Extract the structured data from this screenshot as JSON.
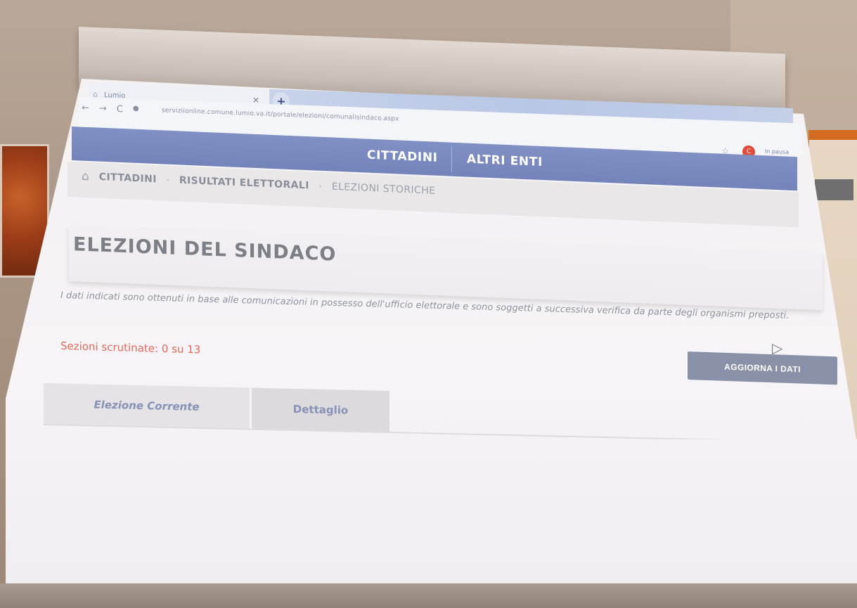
{
  "browser": {
    "tab_title": "Lumio",
    "tab_close": "×",
    "new_tab": "+",
    "url": "serviziionline.comune.lumio.va.it/portale/elezioni/comunalisindaco.aspx",
    "nav_back": "←",
    "nav_forward": "→",
    "nav_reload": "C",
    "star": "☆",
    "profile_initial": "C",
    "profile_text": "In pausa"
  },
  "navbar": {
    "items": [
      "CITTADINI",
      "ALTRI ENTI"
    ]
  },
  "breadcrumb": {
    "home_icon": "home-icon",
    "items": [
      "CITTADINI",
      "RISULTATI ELETTORALI",
      "ELEZIONI STORICHE"
    ]
  },
  "page": {
    "title": "ELEZIONI DEL SINDACO",
    "intro": "I dati indicati sono ottenuti in base alle comunicazioni in possesso dell'ufficio elettorale e sono soggetti a successiva verifica da parte degli organismi preposti.",
    "sections_counted": "Sezioni scrutinate: 0 su 13",
    "refresh_button": "AGGIORNA I DATI"
  },
  "tabs": [
    "Elezione Corrente",
    "Dettaglio"
  ],
  "colors": {
    "navbar": "#7484ba",
    "alert_text": "#e36a5a",
    "button": "#8991a8",
    "tab_text": "#8792b6"
  }
}
